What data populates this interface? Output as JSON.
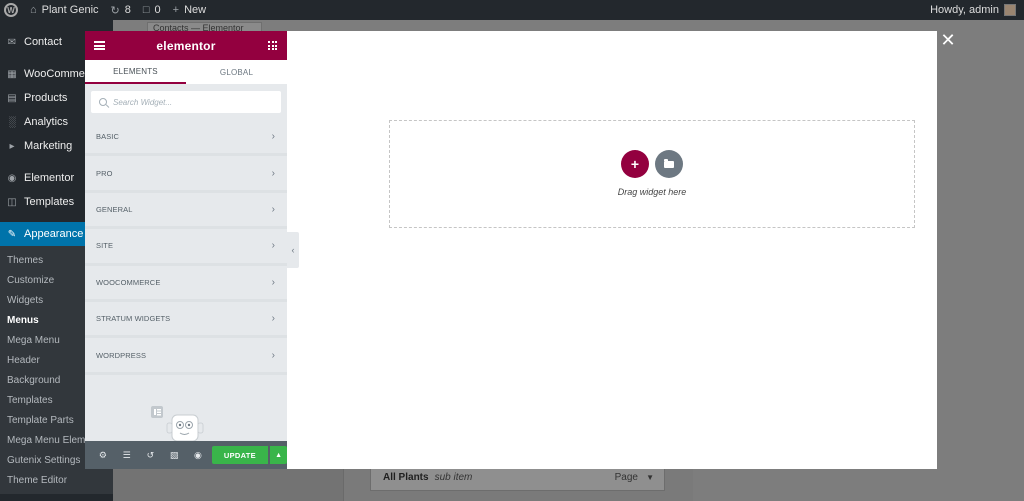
{
  "adminbar": {
    "site_name": "Plant Genic",
    "updates_count": "8",
    "comments_count": "0",
    "new_label": "New",
    "howdy": "Howdy, admin"
  },
  "wp_sidebar": {
    "items": [
      {
        "label": "Contact",
        "icon": "mail-icon"
      },
      {
        "label": "WooCommerce",
        "icon": "woo-icon"
      },
      {
        "label": "Products",
        "icon": "archive-icon"
      },
      {
        "label": "Analytics",
        "icon": "bar-chart-icon"
      },
      {
        "label": "Marketing",
        "icon": "megaphone-icon"
      },
      {
        "label": "Elementor",
        "icon": "elementor-icon"
      },
      {
        "label": "Templates",
        "icon": "folder-icon"
      },
      {
        "label": "Appearance",
        "icon": "brush-icon"
      }
    ],
    "submenu": [
      "Themes",
      "Customize",
      "Widgets",
      "Menus",
      "Mega Menu",
      "Header",
      "Background",
      "Templates",
      "Template Parts",
      "Mega Menu Elements",
      "Gutenix Settings",
      "Theme Editor"
    ],
    "current_submenu": "Menus"
  },
  "background": {
    "breadcrumb": "Contacts — Elementor",
    "menu_row": {
      "title": "All Plants",
      "subtitle": "sub item",
      "type": "Page"
    }
  },
  "elementor": {
    "logo": "elementor",
    "tabs": [
      "ELEMENTS",
      "GLOBAL"
    ],
    "active_tab": "ELEMENTS",
    "search_placeholder": "Search Widget...",
    "categories": [
      "BASIC",
      "PRO",
      "GENERAL",
      "SITE",
      "WOOCOMMERCE",
      "STRATUM WIDGETS",
      "WORDPRESS"
    ],
    "update_label": "UPDATE",
    "accent": "#93003f",
    "update_color": "#39b54a"
  },
  "canvas": {
    "drop_text": "Drag widget here"
  }
}
